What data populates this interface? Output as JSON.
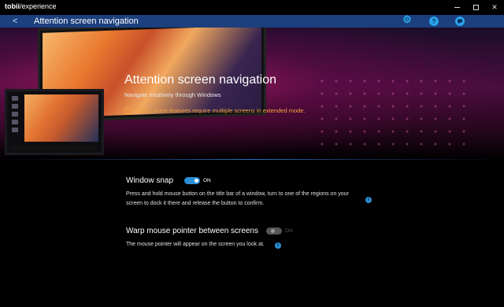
{
  "titlebar": {
    "brand_bold": "tobii",
    "brand_rest": "/experience"
  },
  "header": {
    "back_glyph": "<",
    "title": "Attention screen navigation",
    "icons": [
      "gear-icon",
      "help-icon",
      "chat-icon"
    ],
    "help_glyph": "?",
    "accent": "#2aa3e8",
    "background": "#1c3f7d"
  },
  "hero": {
    "title": "Attention screen navigation",
    "subtitle": "Navigate intuitively through Windows",
    "warning": "Sorry, some features require multiple screens in extended mode.",
    "warning_color": "#f2a33a"
  },
  "settings": [
    {
      "title": "Window snap",
      "toggle_state": "ON",
      "enabled": true,
      "description_lines": [
        "Press and hold mouse button on the title bar of a window, turn to one of the regions on your",
        "screen to dock it there and release the button to confirm."
      ]
    },
    {
      "title": "Warp mouse pointer between screens",
      "toggle_state": "ON",
      "enabled": false,
      "description_lines": [
        "The mouse pointer will appear on the screen you look at."
      ]
    }
  ],
  "colors": {
    "toggle_on": "#2a8fd6",
    "toggle_disabled": "#555555",
    "info": "#2a8fd6"
  }
}
